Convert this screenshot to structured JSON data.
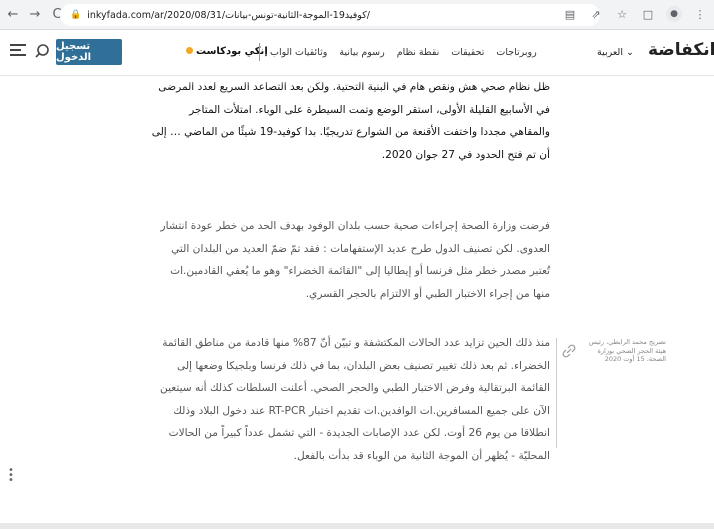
{
  "browser": {
    "back_glyph": "←",
    "forward_glyph": "→",
    "reload_glyph": "C",
    "url": "inkyfada.com/ar/2020/08/31/كوفيد19-الموجة-الثانية-تونس-بيانات/"
  },
  "header": {
    "logo_text": "انكفاضة",
    "language": "العربية ⌄",
    "nav_items": [
      "روبرتاجات",
      "تحقيقات",
      "نقطة نظام",
      "رسوم بيانية",
      "وثائقيات الواب"
    ],
    "podcast_label": "إنكي بودكاست",
    "login_label": "تسجيل الدخول",
    "accent_color": "#2f6f98"
  },
  "article": {
    "paragraph1": "ظل نظام صحي هش ونقص هام في البنية التحتية. ولكن بعد التصاعد السريع لعدد المرضى في الأسابيع القليلة الأولى، استقر الوضع وتمت السيطرة على الوباء. امتلأت المتاجر والمقاهي مجددا واختفت الأقنعة من الشوارع تدريجيًا. بدا كوفيد-19 شيئًا من الماضي … إلى أن تم فتح الحدود في 27 جوان 2020.",
    "paragraph2": "فرضت وزارة الصحة إجراءات صحية حسب بلدان الوفود بهدف الحد من خطر عودة انتشار العدوى. لكن تصنيف الدول طرح عديد الإستفهامات : فقد تمّ ضمّ العديد من البلدان التي تُعتبر مصدر خطر مثل فرنسا أو إيطاليا إلى \"القائمة الخضراء\" وهو ما يُعفي القادمين.ات منها من إجراء الاختبار الطبي أو الالتزام بالحجر القسري.",
    "paragraph3": "منذ ذلك الحين تزايد عدد الحالات المكتشفة و تبيّن أنّ 87% منها قادمة من مناطق القائمة الخضراء. ثم بعد ذلك تغيير تصنيف بعض البلدان، بما في ذلك فرنسا وبلجيكا وضعها إلى القائمة البرتقالية وفرض الاختبار الطبي والحجر الصحي. أعلنت السلطات كذلك أنه سيتعين الآن على جميع المسافرين.ات الوافدين.ات تقديم اختبار RT-PCR عند دخول البلاد وذلك انطلاقا من يوم 26 أوت. لكن عدد الإصابات الجديدة - التي تشمل عدداً كبيراً من الحالات المحليّة - يُظهر أن الموجة الثانية من الوباء قد بدأت بالفعل.",
    "caption": "تصريح محمد الرابطي، رئيس هيئة الحجر الصحي بوزارة الصحة، 15 أوت 2020"
  }
}
